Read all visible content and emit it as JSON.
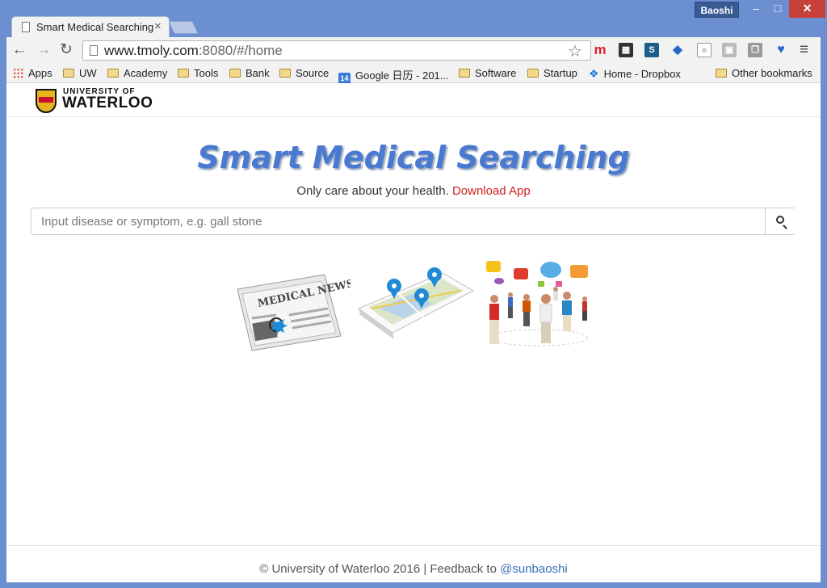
{
  "window": {
    "profile": "Baoshi",
    "minimize": "–",
    "maximize": "□",
    "close": "✕"
  },
  "tab": {
    "title": "Smart Medical Searching",
    "close": "×"
  },
  "toolbar": {
    "back": "←",
    "forward": "→",
    "reload": "↻",
    "url_host": "www.tmoly.com",
    "url_rest": ":8080/#/home",
    "star": "☆",
    "menu": "≡",
    "extensions": [
      "m-icon",
      "film-icon",
      "s-icon",
      "graduation-icon",
      "doc-icon",
      "camera-icon",
      "copy-icon",
      "shield-icon"
    ]
  },
  "bookmarks": {
    "apps": "Apps",
    "items": [
      "UW",
      "Academy",
      "Tools",
      "Bank",
      "Source"
    ],
    "google": "Google 日历 - 201...",
    "google_badge": "14",
    "items2": [
      "Software",
      "Startup"
    ],
    "dropbox": "Home - Dropbox",
    "other": "Other bookmarks"
  },
  "page": {
    "logo_small": "UNIVERSITY OF",
    "logo_big": "WATERLOO",
    "headline": "Smart Medical Searching",
    "subline": "Only care about your health.",
    "download": "Download App",
    "search_placeholder": "Input disease or symptom, e.g. gall stone",
    "news_label": "MEDICAL NEWS",
    "footer_text": "© University of Waterloo 2016 | Feedback to",
    "footer_link": "@sunbaoshi"
  }
}
